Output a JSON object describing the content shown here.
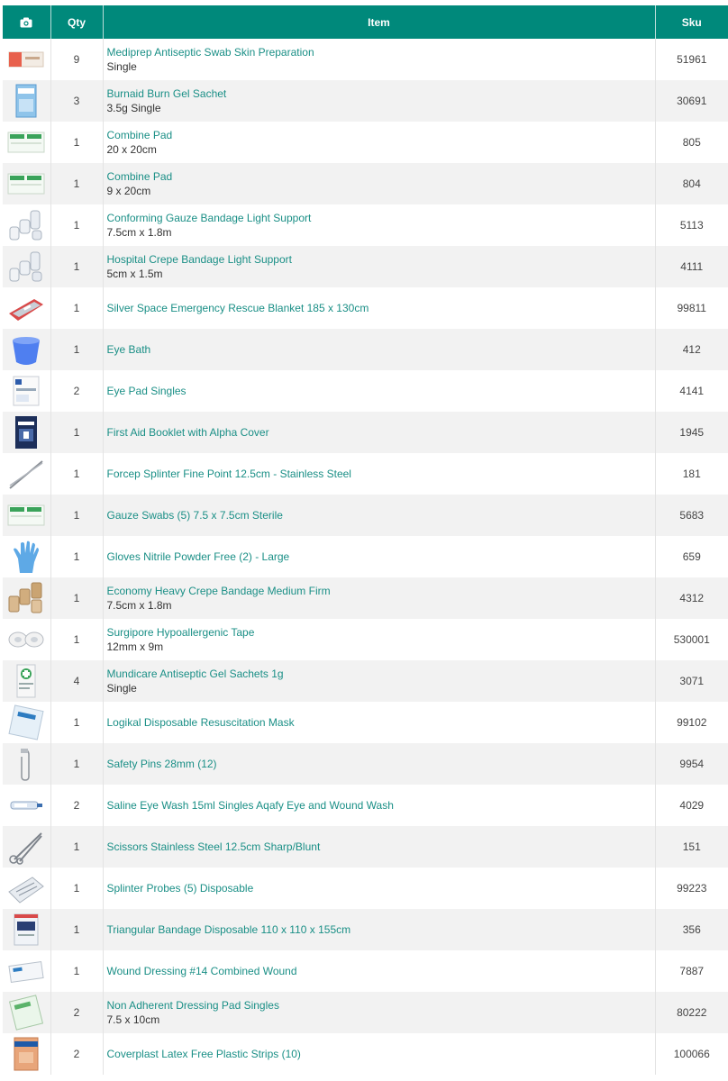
{
  "header": {
    "photo_icon": "camera-icon",
    "qty": "Qty",
    "item": "Item",
    "sku": "Sku"
  },
  "colors": {
    "header_bg": "#00897b",
    "link": "#1a8f86"
  },
  "rows": [
    {
      "qty": "9",
      "name": "Mediprep Antiseptic Swab Skin Preparation",
      "variant": "Single",
      "sku": "51961",
      "thumb": "box"
    },
    {
      "qty": "3",
      "name": "Burnaid Burn Gel Sachet",
      "variant": "3.5g Single",
      "sku": "30691",
      "thumb": "sachet"
    },
    {
      "qty": "1",
      "name": "Combine Pad",
      "variant": "20 x 20cm",
      "sku": "805",
      "thumb": "pad"
    },
    {
      "qty": "1",
      "name": "Combine Pad",
      "variant": "9 x 20cm",
      "sku": "804",
      "thumb": "pad"
    },
    {
      "qty": "1",
      "name": "Conforming Gauze Bandage Light Support",
      "variant": "7.5cm x 1.8m",
      "sku": "5113",
      "thumb": "rolls"
    },
    {
      "qty": "1",
      "name": "Hospital Crepe Bandage Light Support",
      "variant": "5cm x 1.5m",
      "sku": "4111",
      "thumb": "rolls"
    },
    {
      "qty": "1",
      "name": "Silver Space Emergency Rescue Blanket 185 x 130cm",
      "variant": "",
      "sku": "99811",
      "thumb": "blanket"
    },
    {
      "qty": "1",
      "name": "Eye Bath",
      "variant": "",
      "sku": "412",
      "thumb": "cup"
    },
    {
      "qty": "2",
      "name": "Eye Pad Singles",
      "variant": "",
      "sku": "4141",
      "thumb": "packet"
    },
    {
      "qty": "1",
      "name": "First Aid Booklet with Alpha Cover",
      "variant": "",
      "sku": "1945",
      "thumb": "booklet"
    },
    {
      "qty": "1",
      "name": "Forcep Splinter Fine Point 12.5cm - Stainless Steel",
      "variant": "",
      "sku": "181",
      "thumb": "forcep"
    },
    {
      "qty": "1",
      "name": "Gauze Swabs (5) 7.5 x 7.5cm Sterile",
      "variant": "",
      "sku": "5683",
      "thumb": "pad"
    },
    {
      "qty": "1",
      "name": "Gloves Nitrile Powder Free (2) - Large",
      "variant": "",
      "sku": "659",
      "thumb": "glove"
    },
    {
      "qty": "1",
      "name": "Economy Heavy Crepe Bandage Medium Firm",
      "variant": "7.5cm x 1.8m",
      "sku": "4312",
      "thumb": "crepe"
    },
    {
      "qty": "1",
      "name": "Surgipore Hypoallergenic Tape",
      "variant": "12mm x 9m",
      "sku": "530001",
      "thumb": "tape"
    },
    {
      "qty": "4",
      "name": "Mundicare Antiseptic Gel Sachets 1g",
      "variant": "Single",
      "sku": "3071",
      "thumb": "gel"
    },
    {
      "qty": "1",
      "name": "Logikal Disposable Resuscitation Mask",
      "variant": "",
      "sku": "99102",
      "thumb": "mask"
    },
    {
      "qty": "1",
      "name": "Safety Pins 28mm (12)",
      "variant": "",
      "sku": "9954",
      "thumb": "pin"
    },
    {
      "qty": "2",
      "name": "Saline Eye Wash 15ml Singles Aqafy Eye and Wound Wash",
      "variant": "",
      "sku": "4029",
      "thumb": "vial"
    },
    {
      "qty": "1",
      "name": "Scissors Stainless Steel 12.5cm Sharp/Blunt",
      "variant": "",
      "sku": "151",
      "thumb": "scissors"
    },
    {
      "qty": "1",
      "name": "Splinter Probes (5) Disposable",
      "variant": "",
      "sku": "99223",
      "thumb": "probes"
    },
    {
      "qty": "1",
      "name": "Triangular Bandage Disposable 110 x 110 x 155cm",
      "variant": "",
      "sku": "356",
      "thumb": "bag"
    },
    {
      "qty": "1",
      "name": "Wound Dressing #14 Combined Wound",
      "variant": "",
      "sku": "7887",
      "thumb": "dressing"
    },
    {
      "qty": "2",
      "name": "Non Adherent Dressing Pad Singles",
      "variant": "7.5 x 10cm",
      "sku": "80222",
      "thumb": "nonadh"
    },
    {
      "qty": "2",
      "name": "Coverplast Latex Free Plastic Strips (10)",
      "variant": "",
      "sku": "100066",
      "thumb": "strips"
    }
  ]
}
